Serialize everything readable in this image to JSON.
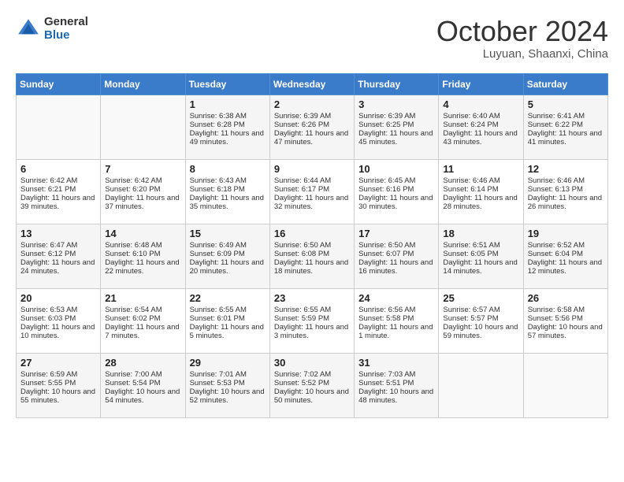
{
  "header": {
    "logo_general": "General",
    "logo_blue": "Blue",
    "month": "October 2024",
    "location": "Luyuan, Shaanxi, China"
  },
  "days_of_week": [
    "Sunday",
    "Monday",
    "Tuesday",
    "Wednesday",
    "Thursday",
    "Friday",
    "Saturday"
  ],
  "weeks": [
    [
      {
        "day": "",
        "info": ""
      },
      {
        "day": "",
        "info": ""
      },
      {
        "day": "1",
        "sunrise": "Sunrise: 6:38 AM",
        "sunset": "Sunset: 6:28 PM",
        "daylight": "Daylight: 11 hours and 49 minutes."
      },
      {
        "day": "2",
        "sunrise": "Sunrise: 6:39 AM",
        "sunset": "Sunset: 6:26 PM",
        "daylight": "Daylight: 11 hours and 47 minutes."
      },
      {
        "day": "3",
        "sunrise": "Sunrise: 6:39 AM",
        "sunset": "Sunset: 6:25 PM",
        "daylight": "Daylight: 11 hours and 45 minutes."
      },
      {
        "day": "4",
        "sunrise": "Sunrise: 6:40 AM",
        "sunset": "Sunset: 6:24 PM",
        "daylight": "Daylight: 11 hours and 43 minutes."
      },
      {
        "day": "5",
        "sunrise": "Sunrise: 6:41 AM",
        "sunset": "Sunset: 6:22 PM",
        "daylight": "Daylight: 11 hours and 41 minutes."
      }
    ],
    [
      {
        "day": "6",
        "sunrise": "Sunrise: 6:42 AM",
        "sunset": "Sunset: 6:21 PM",
        "daylight": "Daylight: 11 hours and 39 minutes."
      },
      {
        "day": "7",
        "sunrise": "Sunrise: 6:42 AM",
        "sunset": "Sunset: 6:20 PM",
        "daylight": "Daylight: 11 hours and 37 minutes."
      },
      {
        "day": "8",
        "sunrise": "Sunrise: 6:43 AM",
        "sunset": "Sunset: 6:18 PM",
        "daylight": "Daylight: 11 hours and 35 minutes."
      },
      {
        "day": "9",
        "sunrise": "Sunrise: 6:44 AM",
        "sunset": "Sunset: 6:17 PM",
        "daylight": "Daylight: 11 hours and 32 minutes."
      },
      {
        "day": "10",
        "sunrise": "Sunrise: 6:45 AM",
        "sunset": "Sunset: 6:16 PM",
        "daylight": "Daylight: 11 hours and 30 minutes."
      },
      {
        "day": "11",
        "sunrise": "Sunrise: 6:46 AM",
        "sunset": "Sunset: 6:14 PM",
        "daylight": "Daylight: 11 hours and 28 minutes."
      },
      {
        "day": "12",
        "sunrise": "Sunrise: 6:46 AM",
        "sunset": "Sunset: 6:13 PM",
        "daylight": "Daylight: 11 hours and 26 minutes."
      }
    ],
    [
      {
        "day": "13",
        "sunrise": "Sunrise: 6:47 AM",
        "sunset": "Sunset: 6:12 PM",
        "daylight": "Daylight: 11 hours and 24 minutes."
      },
      {
        "day": "14",
        "sunrise": "Sunrise: 6:48 AM",
        "sunset": "Sunset: 6:10 PM",
        "daylight": "Daylight: 11 hours and 22 minutes."
      },
      {
        "day": "15",
        "sunrise": "Sunrise: 6:49 AM",
        "sunset": "Sunset: 6:09 PM",
        "daylight": "Daylight: 11 hours and 20 minutes."
      },
      {
        "day": "16",
        "sunrise": "Sunrise: 6:50 AM",
        "sunset": "Sunset: 6:08 PM",
        "daylight": "Daylight: 11 hours and 18 minutes."
      },
      {
        "day": "17",
        "sunrise": "Sunrise: 6:50 AM",
        "sunset": "Sunset: 6:07 PM",
        "daylight": "Daylight: 11 hours and 16 minutes."
      },
      {
        "day": "18",
        "sunrise": "Sunrise: 6:51 AM",
        "sunset": "Sunset: 6:05 PM",
        "daylight": "Daylight: 11 hours and 14 minutes."
      },
      {
        "day": "19",
        "sunrise": "Sunrise: 6:52 AM",
        "sunset": "Sunset: 6:04 PM",
        "daylight": "Daylight: 11 hours and 12 minutes."
      }
    ],
    [
      {
        "day": "20",
        "sunrise": "Sunrise: 6:53 AM",
        "sunset": "Sunset: 6:03 PM",
        "daylight": "Daylight: 11 hours and 10 minutes."
      },
      {
        "day": "21",
        "sunrise": "Sunrise: 6:54 AM",
        "sunset": "Sunset: 6:02 PM",
        "daylight": "Daylight: 11 hours and 7 minutes."
      },
      {
        "day": "22",
        "sunrise": "Sunrise: 6:55 AM",
        "sunset": "Sunset: 6:01 PM",
        "daylight": "Daylight: 11 hours and 5 minutes."
      },
      {
        "day": "23",
        "sunrise": "Sunrise: 6:55 AM",
        "sunset": "Sunset: 5:59 PM",
        "daylight": "Daylight: 11 hours and 3 minutes."
      },
      {
        "day": "24",
        "sunrise": "Sunrise: 6:56 AM",
        "sunset": "Sunset: 5:58 PM",
        "daylight": "Daylight: 11 hours and 1 minute."
      },
      {
        "day": "25",
        "sunrise": "Sunrise: 6:57 AM",
        "sunset": "Sunset: 5:57 PM",
        "daylight": "Daylight: 10 hours and 59 minutes."
      },
      {
        "day": "26",
        "sunrise": "Sunrise: 6:58 AM",
        "sunset": "Sunset: 5:56 PM",
        "daylight": "Daylight: 10 hours and 57 minutes."
      }
    ],
    [
      {
        "day": "27",
        "sunrise": "Sunrise: 6:59 AM",
        "sunset": "Sunset: 5:55 PM",
        "daylight": "Daylight: 10 hours and 55 minutes."
      },
      {
        "day": "28",
        "sunrise": "Sunrise: 7:00 AM",
        "sunset": "Sunset: 5:54 PM",
        "daylight": "Daylight: 10 hours and 54 minutes."
      },
      {
        "day": "29",
        "sunrise": "Sunrise: 7:01 AM",
        "sunset": "Sunset: 5:53 PM",
        "daylight": "Daylight: 10 hours and 52 minutes."
      },
      {
        "day": "30",
        "sunrise": "Sunrise: 7:02 AM",
        "sunset": "Sunset: 5:52 PM",
        "daylight": "Daylight: 10 hours and 50 minutes."
      },
      {
        "day": "31",
        "sunrise": "Sunrise: 7:03 AM",
        "sunset": "Sunset: 5:51 PM",
        "daylight": "Daylight: 10 hours and 48 minutes."
      },
      {
        "day": "",
        "info": ""
      },
      {
        "day": "",
        "info": ""
      }
    ]
  ]
}
